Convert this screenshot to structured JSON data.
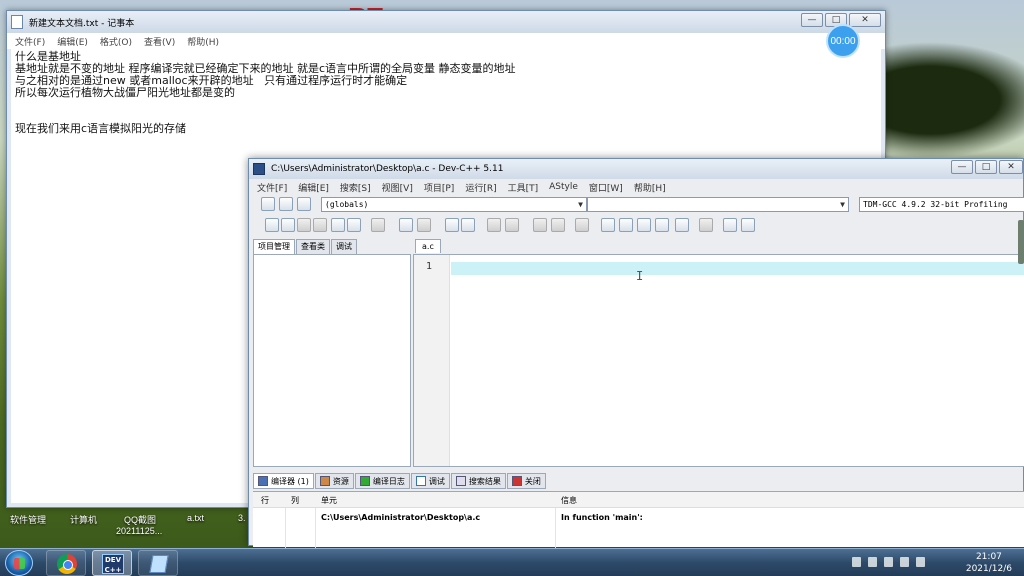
{
  "desktop": {
    "logo_text": "PE",
    "icons": [
      {
        "label": "软件管理"
      },
      {
        "label": "计算机"
      },
      {
        "label": "QQ截图",
        "sublabel": "20211125..."
      },
      {
        "label": "a.txt"
      },
      {
        "label": "3."
      }
    ]
  },
  "notepad": {
    "title": "新建文本文档.txt - 记事本",
    "menu": [
      "文件(F)",
      "编辑(E)",
      "格式(O)",
      "查看(V)",
      "帮助(H)"
    ],
    "window_buttons": {
      "minimize": "—",
      "maximize": "□",
      "close": "✕"
    },
    "lines": [
      "什么是基地址",
      "基地址就是不变的地址 程序编译完就已经确定下来的地址 就是c语言中所谓的全局变量 静态变量的地址",
      "与之相对的是通过new 或者malloc来开辟的地址   只有通过程序运行时才能确定",
      "所以每次运行植物大战僵尸阳光地址都是变的",
      "",
      "",
      "现在我们来用c语言模拟阳光的存储"
    ]
  },
  "timer_badge": "00:00",
  "devcpp": {
    "title": "C:\\Users\\Administrator\\Desktop\\a.c - Dev-C++ 5.11",
    "window_buttons": {
      "minimize": "—",
      "maximize": "□",
      "close": "✕"
    },
    "menu": [
      "文件[F]",
      "编辑[E]",
      "搜索[S]",
      "视图[V]",
      "项目[P]",
      "运行[R]",
      "工具[T]",
      "AStyle",
      "窗口[W]",
      "帮助[H]"
    ],
    "globals_combo": "(globals)",
    "second_combo": "",
    "compiler_combo": "TDM-GCC 4.9.2 32-bit Profiling",
    "project_tabs": [
      "项目管理",
      "查看类",
      "调试"
    ],
    "editor_tab": "a.c",
    "line_numbers": [
      "1"
    ],
    "bottom_tabs": [
      {
        "label": "编译器 (1)",
        "icon": "compiler-icon"
      },
      {
        "label": "资源",
        "icon": "resources-icon"
      },
      {
        "label": "编译日志",
        "icon": "compile-log-icon"
      },
      {
        "label": "调试",
        "icon": "debug-icon"
      },
      {
        "label": "搜索结果",
        "icon": "search-results-icon"
      },
      {
        "label": "关闭",
        "icon": "close-panel-icon"
      }
    ],
    "output": {
      "columns": [
        "行",
        "列",
        "单元",
        "信息"
      ],
      "rows": [
        {
          "line": "",
          "col": "",
          "unit": "C:\\Users\\Administrator\\Desktop\\a.c",
          "message": "In function 'main':"
        }
      ]
    }
  },
  "taskbar": {
    "clock_time": "21:07",
    "clock_date": "2021/12/6"
  }
}
